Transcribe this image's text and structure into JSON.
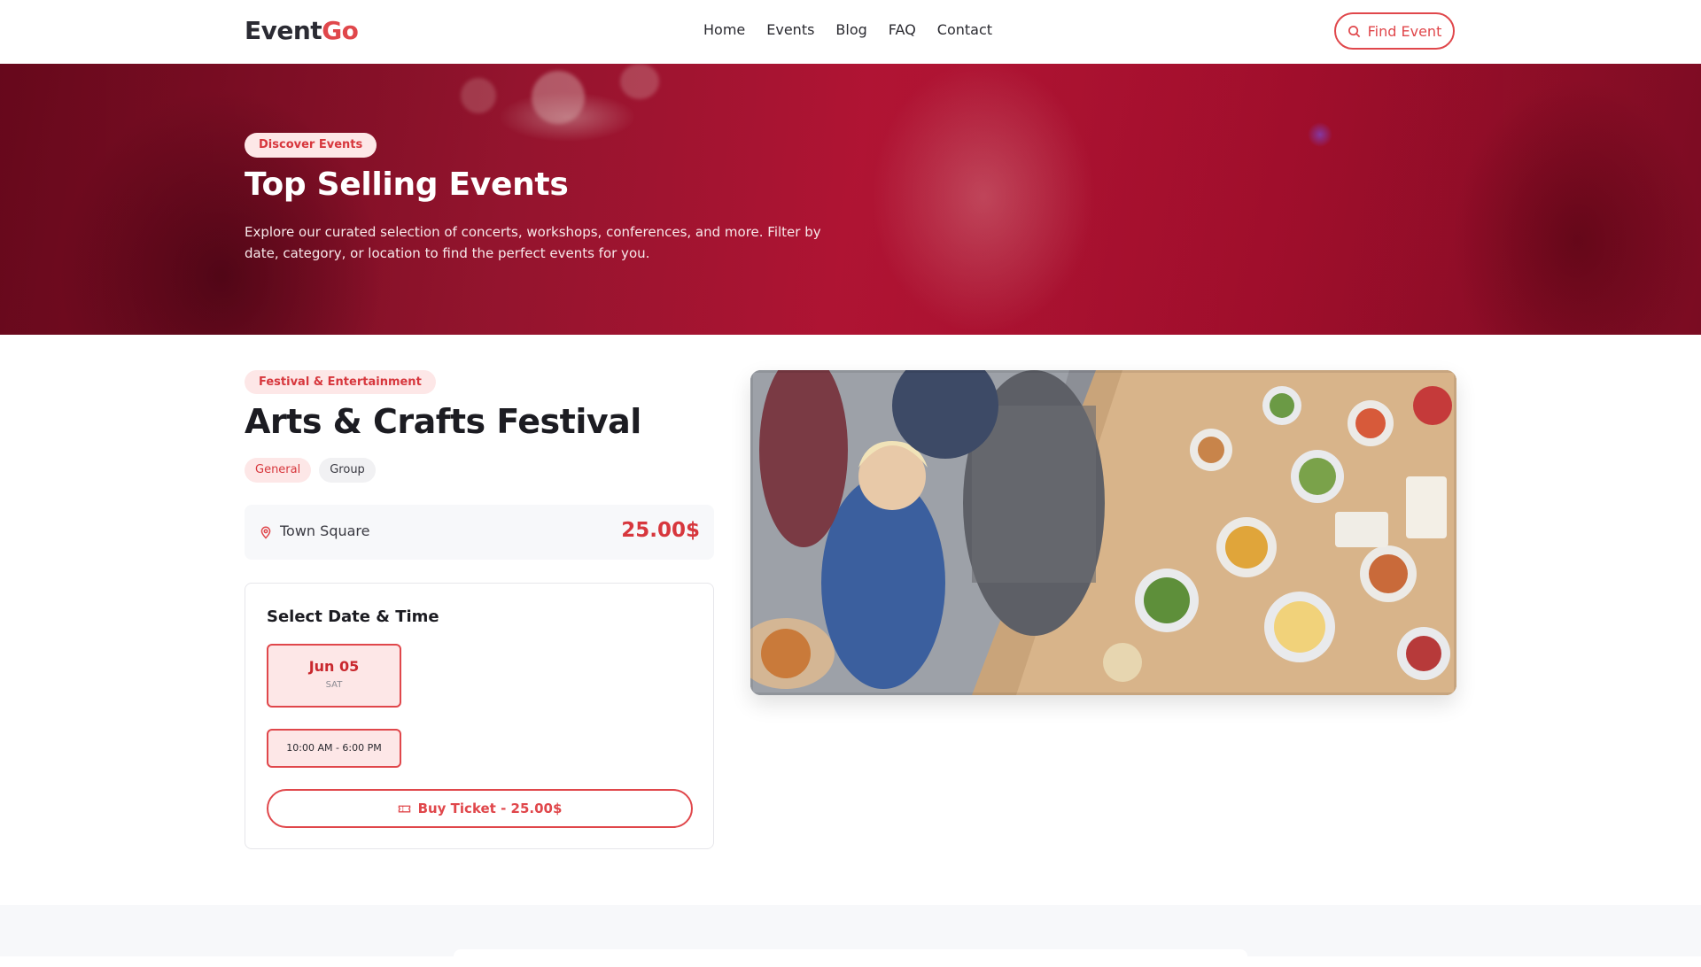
{
  "header": {
    "logo_part1": "Event",
    "logo_part2": "Go",
    "nav": [
      "Home",
      "Events",
      "Blog",
      "FAQ",
      "Contact"
    ],
    "find_button": "Find Event",
    "find_icon": "search-icon"
  },
  "hero": {
    "badge": "Discover Events",
    "title": "Top Selling Events",
    "description": "Explore our curated selection of concerts, workshops, conferences, and more. Filter by date, category, or location to find the perfect events for you."
  },
  "event": {
    "category": "Festival & Entertainment",
    "title": "Arts & Crafts Festival",
    "tags": [
      "General",
      "Group"
    ],
    "location": "Town Square",
    "location_icon": "map-pin-icon",
    "price": "25.00$",
    "schedule": {
      "heading": "Select Date & Time",
      "date": "Jun 05",
      "weekday": "SAT",
      "time": "10:00 AM - 6:00 PM"
    },
    "buy_button": "Buy Ticket - 25.00$",
    "buy_icon": "ticket-icon"
  },
  "colors": {
    "accent": "#e0474b",
    "accent_soft": "#fde7e7",
    "text_dark": "#1c1c22"
  }
}
